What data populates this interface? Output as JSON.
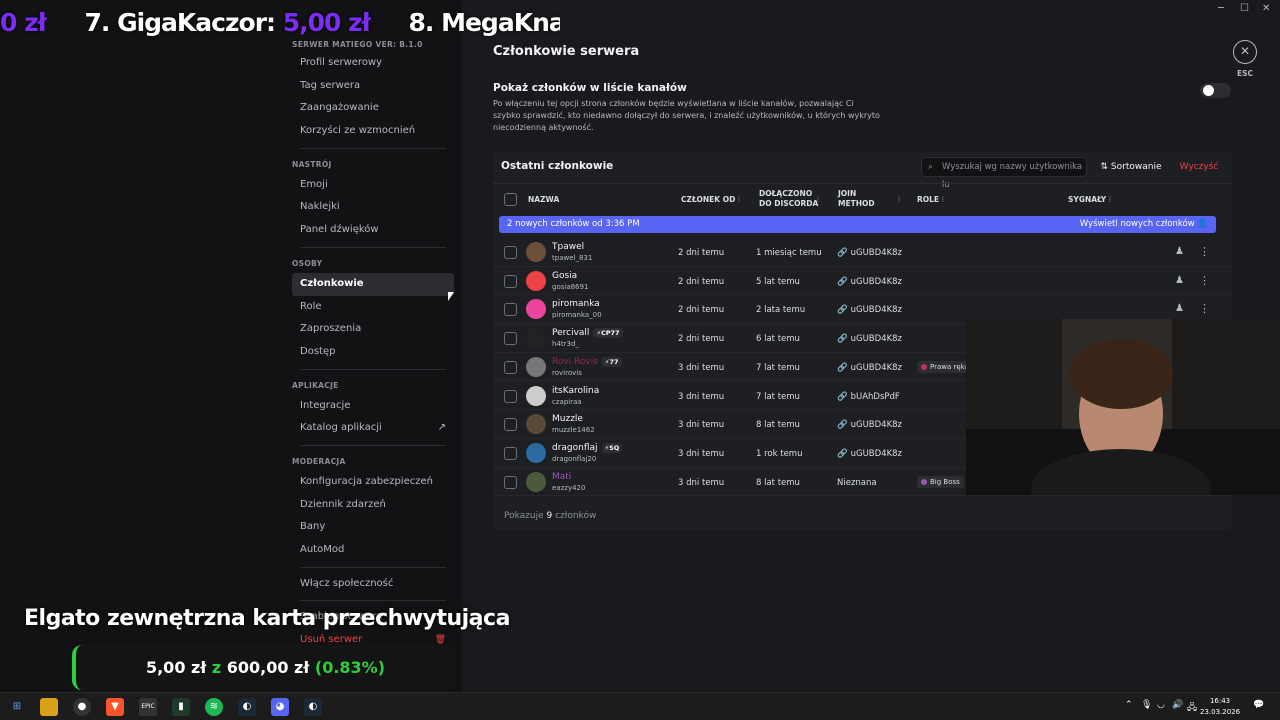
{
  "ticker": {
    "p1": "0 zł",
    "p2": "7. GigaKaczor: ",
    "p3": "5,00 zł",
    "p4": "8. MegaKna"
  },
  "window": {
    "minimize": "─",
    "maximize": "☐",
    "close": "✕"
  },
  "sidebar": {
    "header": "SERWER MATIEGO VER: B.1.0",
    "items_top": [
      "Profil serwerowy",
      "Tag serwera",
      "Zaangażowanie",
      "Korzyści ze wzmocnień"
    ],
    "sec_osoby_label": "NASTRÓJ",
    "items_mood": [
      "Emoji",
      "Naklejki",
      "Panel dźwięków"
    ],
    "sec_people": "OSOBY",
    "items_people": [
      "Członkowie",
      "Role",
      "Zaproszenia",
      "Dostęp"
    ],
    "sec_apps": "APLIKACJE",
    "items_apps": [
      "Integracje",
      "Katalog aplikacji"
    ],
    "sec_mod": "MODERACJA",
    "items_mod": [
      "Konfiguracja zabezpieczeń",
      "Dziennik zdarzeń",
      "Bany",
      "AutoMod"
    ],
    "community": "Włącz społeczność",
    "template": "Szablon serwera",
    "delete": "Usuń serwer"
  },
  "main": {
    "title": "Członkowie serwera",
    "esc": "ESC",
    "toggle_title": "Pokaż członków w liście kanałów",
    "toggle_desc": "Po włączeniu tej opcji strona członków będzie wyświetlana w liście kanałów, pozwalając Ci szybko sprawdzić, kto niedawno dołączył do serwera, i znaleźć użytkowników, u których wykryto niecodzienną aktywność.",
    "panel_title": "Ostatni członkowie",
    "search_placeholder": "Wyszukaj wg nazwy użytkownika lu",
    "sort_label": "Sortowanie",
    "clear_label": "Wyczyść",
    "columns": {
      "name": "NAZWA",
      "member_since": "CZŁONEK OD",
      "joined_discord_1": "DOŁĄCZONO",
      "joined_discord_2": "DO DISCORDA",
      "join_method_1": "JOIN",
      "join_method_2": "METHOD",
      "roles": "ROLE",
      "signals": "SYGNAŁY"
    },
    "banner_left": "2 nowych członków od 3:36 PM",
    "banner_right": "Wyświetl nowych członków",
    "rows": [
      {
        "name": "Tpawel",
        "user": "tpawel_831",
        "since": "2 dni temu",
        "discord": "1 miesiąc temu",
        "method": "uGUBD4K8z",
        "role": "",
        "badge": "",
        "color": "#f2f3f5",
        "av": "#6b4f3a"
      },
      {
        "name": "Gosia",
        "user": "gosia8691",
        "since": "2 dni temu",
        "discord": "5 lat temu",
        "method": "uGUBD4K8z",
        "role": "",
        "badge": "",
        "color": "#f2f3f5",
        "av": "#ed4245"
      },
      {
        "name": "piromanka",
        "user": "piromanka_00",
        "since": "2 dni temu",
        "discord": "2 lata temu",
        "method": "uGUBD4K8z",
        "role": "",
        "badge": "",
        "color": "#f2f3f5",
        "av": "#eb459e"
      },
      {
        "name": "Percivall",
        "user": "h4tr3d_",
        "since": "2 dni temu",
        "discord": "6 lat temu",
        "method": "uGUBD4K8z",
        "role": "",
        "badge": "⚡CP77",
        "color": "#f2f3f5",
        "av": "#222"
      },
      {
        "name": "Rovi Rovis",
        "user": "rovirovis",
        "since": "3 dni temu",
        "discord": "7 lat temu",
        "method": "uGUBD4K8z",
        "role": "Prawa ręka",
        "badge": "⚡77",
        "color": "#8e2a4a",
        "av": "#777"
      },
      {
        "name": "itsKarolina",
        "user": "czapiraa",
        "since": "3 dni temu",
        "discord": "7 lat temu",
        "method": "bUAhDsPdF",
        "role": "",
        "badge": "",
        "color": "#f2f3f5",
        "av": "#ccc"
      },
      {
        "name": "Muzzle",
        "user": "muzzle1462",
        "since": "3 dni temu",
        "discord": "8 lat temu",
        "method": "uGUBD4K8z",
        "role": "",
        "badge": "",
        "color": "#f2f3f5",
        "av": "#5a4a3a"
      },
      {
        "name": "dragonflaj",
        "user": "dragonflaj20",
        "since": "3 dni temu",
        "discord": "1 rok temu",
        "method": "uGUBD4K8z",
        "role": "",
        "badge": "⚡SQ",
        "color": "#f2f3f5",
        "av": "#2a6aa0"
      },
      {
        "name": "Mati",
        "user": "eazzy420",
        "since": "3 dni temu",
        "discord": "8 lat temu",
        "method": "Nieznana",
        "role": "Big Boss",
        "badge": "",
        "color": "#9b59b6",
        "av": "#4a5a3a"
      }
    ],
    "footer_prefix": "Pokazuje ",
    "footer_count": "9",
    "footer_suffix": " członków"
  },
  "overlay": {
    "title": "Elgato zewnętrzna karta przechwytująca",
    "goal_current": "5,00 zł",
    "goal_z": "z",
    "goal_target": "600,00 zł",
    "goal_pct": "(0.83%)"
  },
  "taskbar": {
    "time": "16:43",
    "date": "23.03.2026"
  }
}
